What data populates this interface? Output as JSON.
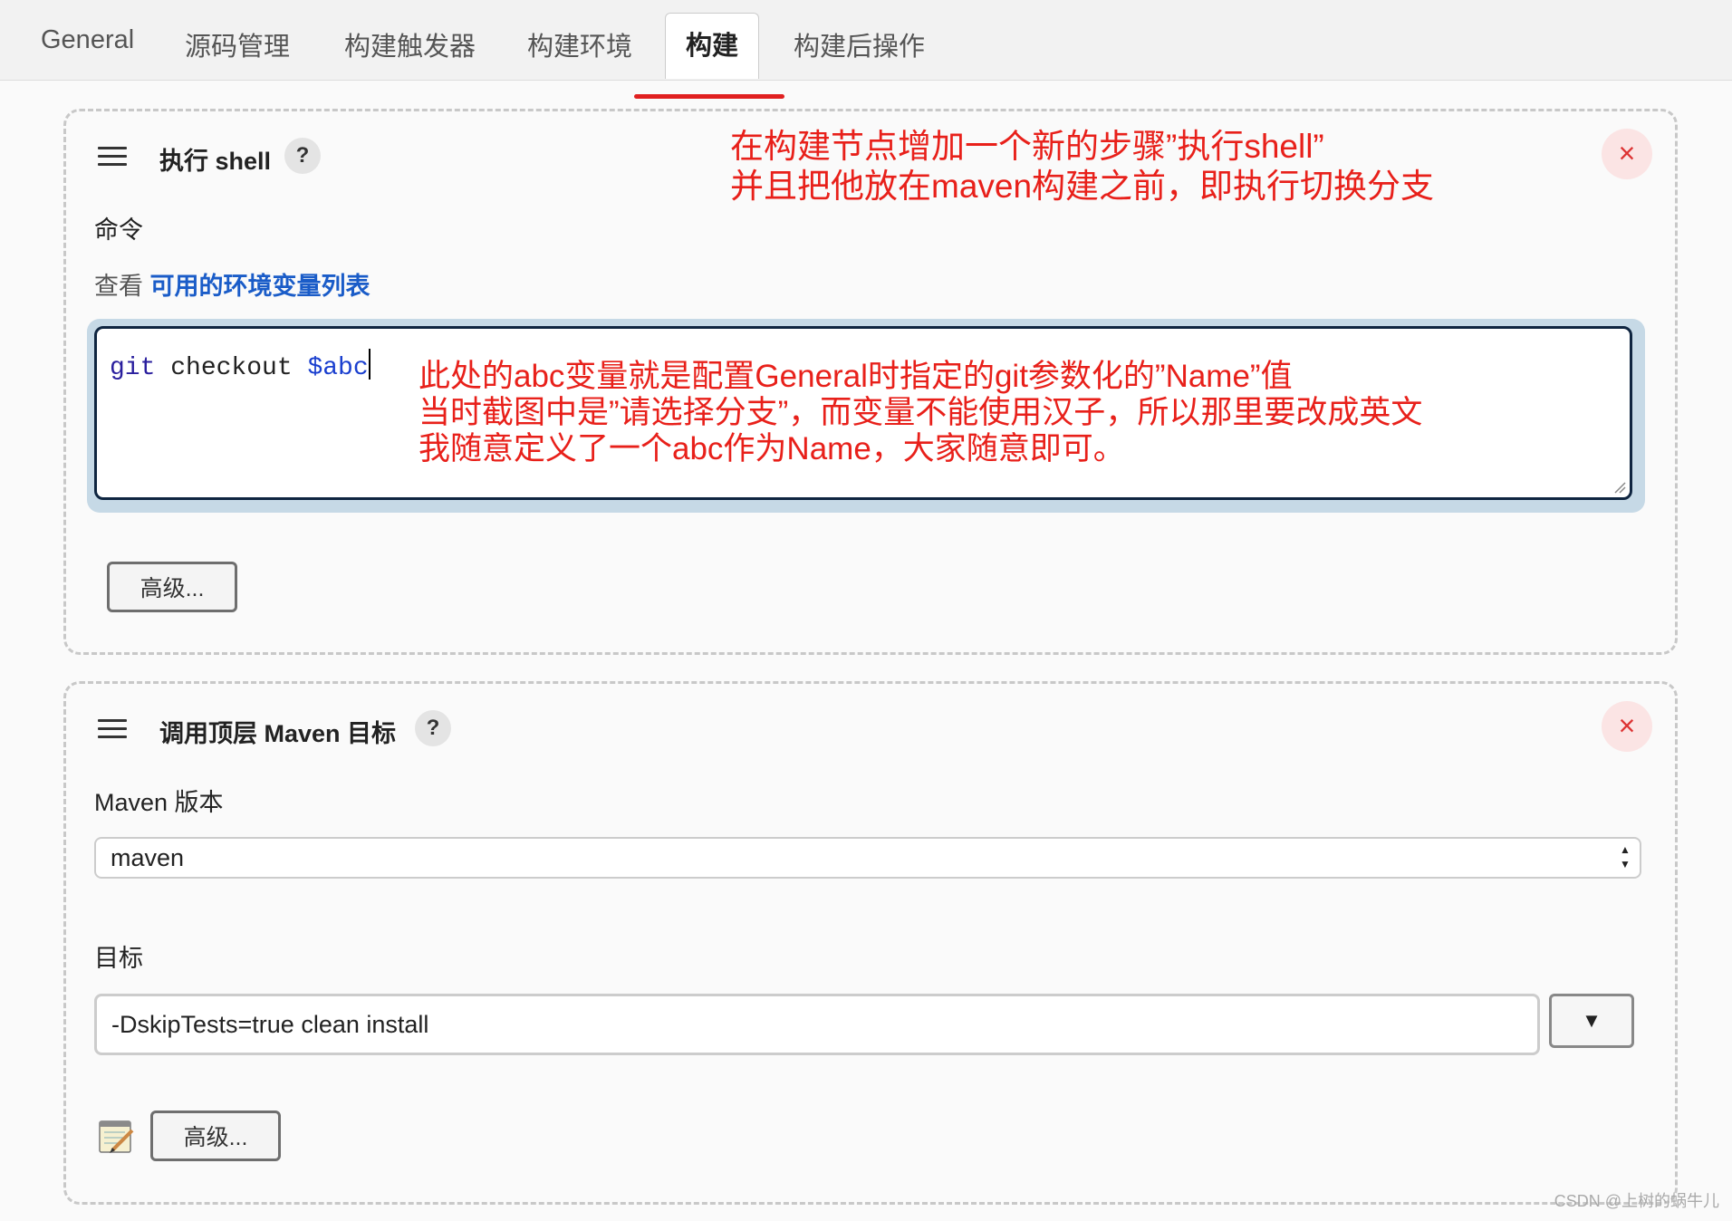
{
  "tabs": [
    {
      "label": "General"
    },
    {
      "label": "源码管理"
    },
    {
      "label": "构建触发器"
    },
    {
      "label": "构建环境"
    },
    {
      "label": "构建",
      "active": true
    },
    {
      "label": "构建后操作"
    }
  ],
  "shell_step": {
    "title": "执行 shell",
    "help": "?",
    "close": "×",
    "command_label": "命令",
    "env_prefix": "查看",
    "env_link": "可用的环境变量列表",
    "command_tokens": {
      "kw": "git",
      "plain": " checkout ",
      "var": "$abc"
    },
    "advanced_button": "高级..."
  },
  "maven_step": {
    "title": "调用顶层 Maven 目标",
    "help": "?",
    "close": "×",
    "version_label": "Maven 版本",
    "version_value": "maven",
    "goals_label": "目标",
    "goals_value": "-DskipTests=true clean install",
    "dropdown": "▼",
    "advanced_button": "高级..."
  },
  "annotations": {
    "top_line1": "在构建节点增加一个新的步骤”执行shell”",
    "top_line2": "并且把他放在maven构建之前，即执行切换分支",
    "cmd_line1": "此处的abc变量就是配置General时指定的git参数化的”Name”值",
    "cmd_line2": "当时截图中是”请选择分支”，而变量不能使用汉子，所以那里要改成英文",
    "cmd_line3": "我随意定义了一个abc作为Name，大家随意即可。"
  },
  "watermark": "CSDN @上树的蜗牛儿",
  "colors": {
    "annotation": "#e8201a",
    "link": "#1a5cc8",
    "focus_border": "#0f2540"
  }
}
